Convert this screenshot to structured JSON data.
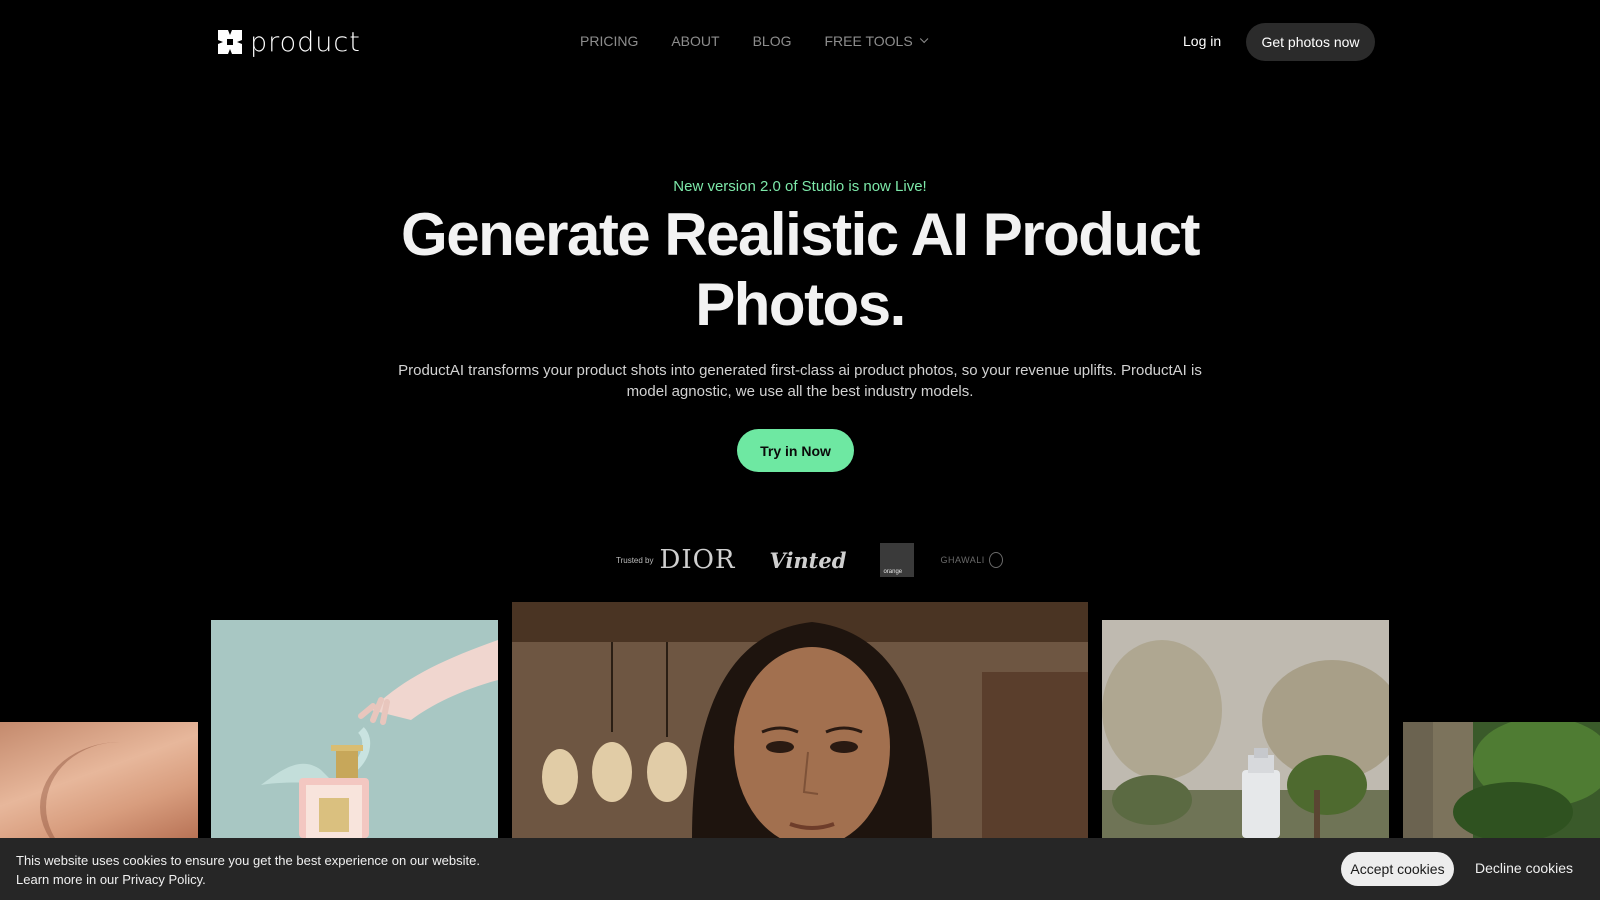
{
  "header": {
    "logo_text": "product",
    "nav": [
      {
        "label": "PRICING"
      },
      {
        "label": "ABOUT"
      },
      {
        "label": "BLOG"
      },
      {
        "label": "FREE TOOLS",
        "icon": "chevron-down-icon"
      }
    ],
    "login_label": "Log in",
    "cta_label": "Get photos now"
  },
  "hero": {
    "announcement": "New version 2.0 of Studio is now Live!",
    "headline": "Generate Realistic AI Product Photos.",
    "subtitle": "ProductAI transforms your product shots into generated first-class ai product photos, so your revenue uplifts. ProductAI is model agnostic, we use all the best industry models.",
    "cta_label": "Try in Now"
  },
  "trusted": {
    "label": "Trusted by",
    "logos": [
      "DIOR",
      "Vinted",
      "orange",
      "GHAWALI"
    ]
  },
  "gallery": [
    {
      "subject": "skin close-up"
    },
    {
      "subject": "perfume bottle with hand"
    },
    {
      "subject": "woman portrait"
    },
    {
      "subject": "spray bottle with bonsai"
    },
    {
      "subject": "stone pillar with foliage"
    }
  ],
  "cookie": {
    "line1": "This website uses cookies to ensure you get the best experience on our website.",
    "line2": "Learn more in our Privacy Policy.",
    "accept_label": "Accept cookies",
    "decline_label": "Decline cookies"
  },
  "colors": {
    "accent_green": "#6ee8a2",
    "announce_green": "#7de8a9",
    "background": "#000000",
    "cookie_bg": "#262626"
  }
}
